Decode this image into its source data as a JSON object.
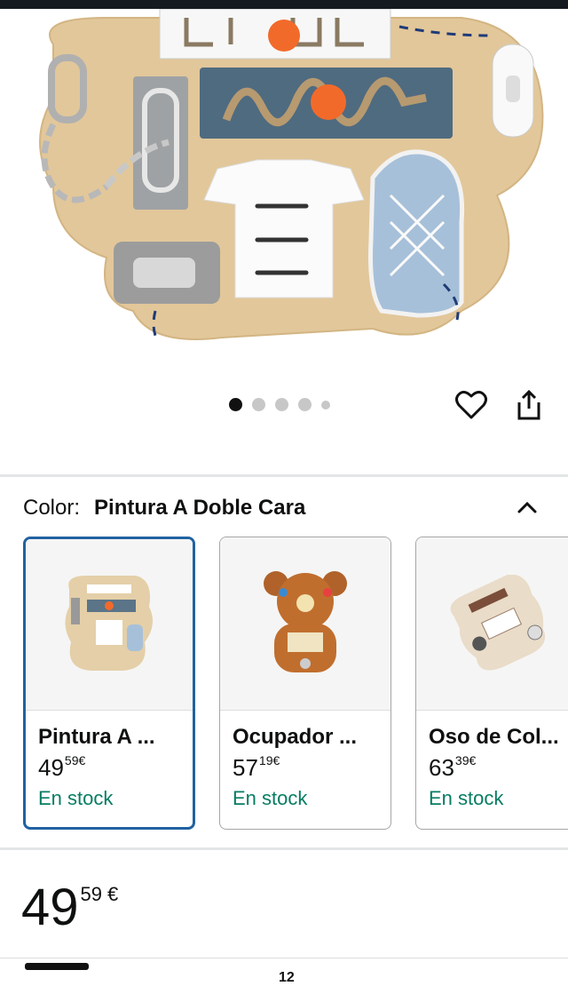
{
  "gallery": {
    "dots": 5,
    "active_index": 0
  },
  "actions": {
    "favorite_icon": "heart-icon",
    "share_icon": "share-icon"
  },
  "color_selector": {
    "label": "Color:",
    "selected": "Pintura A Doble Cara",
    "collapse_icon": "chevron-up-icon"
  },
  "variants": [
    {
      "name": "Pintura A ...",
      "price_whole": "49",
      "price_cents": "59",
      "currency": "€",
      "stock": "En stock",
      "selected": true
    },
    {
      "name": "Ocupador ...",
      "price_whole": "57",
      "price_cents": "19",
      "currency": "€",
      "stock": "En stock",
      "selected": false
    },
    {
      "name": "Oso de Col...",
      "price_whole": "63",
      "price_cents": "39",
      "currency": "€",
      "stock": "En stock",
      "selected": false
    }
  ],
  "price": {
    "whole": "49",
    "cents": "59",
    "currency": "€"
  },
  "bottom": {
    "cart_count": "12"
  },
  "colors": {
    "accent_blue": "#2162a1",
    "stock_green": "#067d62"
  }
}
